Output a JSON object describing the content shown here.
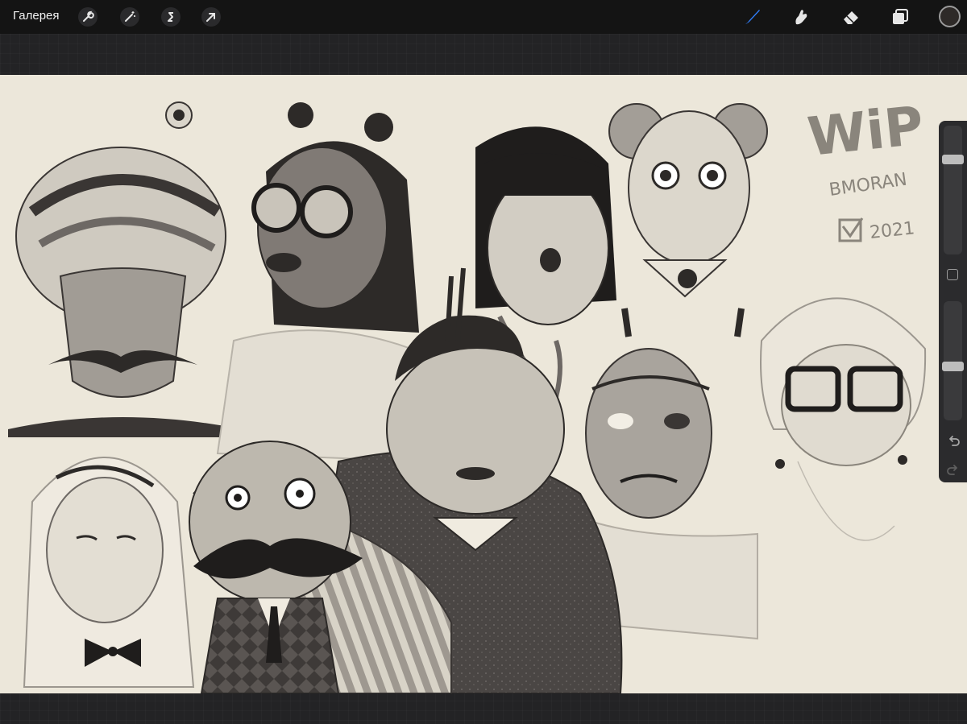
{
  "toolbar": {
    "gallery_label": "Галерея",
    "left_tools": [
      {
        "name": "actions",
        "icon": "wrench-icon"
      },
      {
        "name": "adjustments",
        "icon": "magic-wand-icon"
      },
      {
        "name": "selection",
        "icon": "selection-s-icon"
      },
      {
        "name": "transform",
        "icon": "arrow-cursor-icon"
      }
    ],
    "right_tools": [
      {
        "name": "brush",
        "icon": "brush-icon",
        "active": true
      },
      {
        "name": "smudge",
        "icon": "smudge-finger-icon"
      },
      {
        "name": "eraser",
        "icon": "eraser-icon"
      },
      {
        "name": "layers",
        "icon": "layers-icon"
      }
    ],
    "current_color": "#2e2a28",
    "accent_color": "#2f7cf6"
  },
  "sidebar": {
    "brush_size_level": 0.24,
    "opacity_level": 0.55,
    "icons": [
      "modify-square-icon",
      "undo-icon",
      "redo-icon"
    ]
  },
  "canvas": {
    "paper_color": "#ece7da",
    "handwritten": {
      "wip": "WiP",
      "author": "BMORAN",
      "year": "2021"
    }
  }
}
